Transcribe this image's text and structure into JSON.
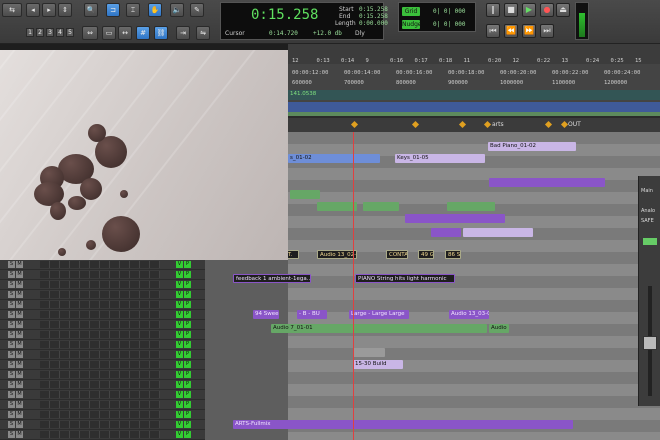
{
  "counter": {
    "main_time": "0:15.258",
    "start_label": "Start",
    "start_value": "0:15.258",
    "end_label": "End",
    "end_value": "0:15.258",
    "length_label": "Length",
    "length_value": "0:00.000",
    "cursor_label": "Cursor",
    "cursor_value": "0:14.720",
    "db_value": "+12.0 db",
    "dly_label": "Dly"
  },
  "grid_nudge": {
    "grid_label": "Grid",
    "grid_value": "0| 0| 000",
    "nudge_label": "Nudge",
    "nudge_value": "0| 0| 000"
  },
  "ruler": {
    "bars": [
      "12",
      "0:13",
      "0:14",
      "9",
      "0:16",
      "0:17",
      "0:18",
      "11",
      "0:20",
      "12",
      "0:22",
      "13",
      "0:24",
      "0:25",
      "15"
    ],
    "timecodes": [
      "00:00:12:00",
      "00:00:14:00",
      "00:00:16:00",
      "00:00:18:00",
      "00:00:20:00",
      "00:00:22:00",
      "00:00:24:00"
    ],
    "samples": [
      "600000",
      "700000",
      "800000",
      "900000",
      "1000000",
      "1100000",
      "1200000"
    ],
    "tempo_label": "141.0538"
  },
  "markers": [
    {
      "label": "arts"
    },
    {
      "label": "OUT"
    }
  ],
  "clips": {
    "bad_piano": "Bad Piano_01-02",
    "keys_01_02": "s_01-02",
    "keys_01_05": "Keys_01-05",
    "audio13": "Audio 13_02-0",
    "int": "INT.",
    "conta": "CONTA",
    "clip_49g": "49 G",
    "clip_86s": "86 S",
    "feedback": "feedback 1 ambient-1ega...",
    "piano_string": "PIANO String hits light harmonic",
    "sweep": "94 Swee",
    "bfi": "- B - BU",
    "large1": "Large - Large",
    "large2": "Large",
    "audio13b": "Audio 13_03-0",
    "audio7": "Audio 7_01-01",
    "audio_end": "Audio",
    "build": "15-30 Build",
    "arts_fullmix": "ARTS-Fullmix"
  },
  "mixer": {
    "name": "Main",
    "safe": "SAFE",
    "analog": "Analo"
  }
}
